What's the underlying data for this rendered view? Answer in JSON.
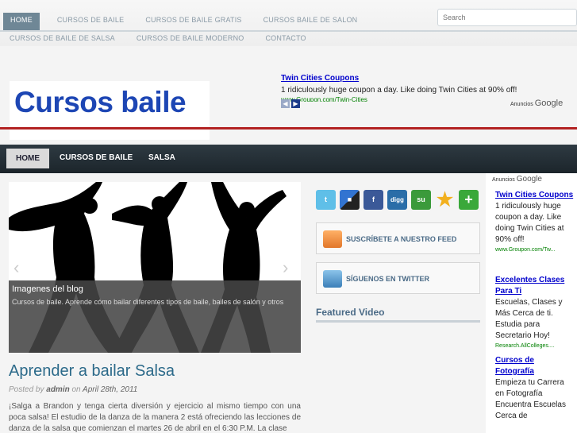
{
  "topnav": {
    "row1": [
      "HOME",
      "CURSOS DE BAILE",
      "CURSOS DE BAILE GRATIS",
      "CURSOS BAILE DE SALON"
    ],
    "row2": [
      "CURSOS DE BAILE DE SALSA",
      "CURSOS DE BAILE MODERNO",
      "CONTACTO"
    ],
    "search_placeholder": "Search"
  },
  "header": {
    "logo": "Cursos baile",
    "ad": {
      "title": "Twin Cities Coupons",
      "body": "1 ridiculously huge coupon a day. Like doing Twin Cities at 90% off!",
      "url": "www.Groupon.com/Twin-Cities"
    },
    "ads_by": "Anuncios",
    "google": "Google",
    "prev_glyph": "◀",
    "next_glyph": "▶"
  },
  "mainnav": [
    "HOME",
    "CURSOS DE BAILE",
    "SALSA"
  ],
  "slider": {
    "caption_title": "Imagenes del blog",
    "caption_text": "Cursos de baile. Aprende cómo bailar diferentes tipos de baile, bailes de salón y otros"
  },
  "post": {
    "title": "Aprender a bailar Salsa",
    "posted_by": "Posted by",
    "author": "admin",
    "on": "on",
    "date": "April 28th, 2011",
    "body": "¡Salga a Brandon y tenga cierta diversión y ejercicio al mismo tiempo con una poca salsa! El estudio de la danza de la manera 2 está ofreciendo las lecciones de danza de la salsa que comienzan el martes 26 de abril en el 6:30 P.M. La clase"
  },
  "sidebar": {
    "social_icons": [
      "twitter-icon",
      "delicious-icon",
      "facebook-icon",
      "digg-icon",
      "stumbleupon-icon",
      "favorite-star-icon",
      "add-more-icon"
    ],
    "social_glyphs": [
      "t",
      "■",
      "f",
      "digg",
      "su",
      "★",
      "+"
    ],
    "feed_label": "SUSCRÍBETE A NUESTRO FEED",
    "twitter_label": "SÍGUENOS EN TWITTER",
    "featured_video": "Featured Video"
  },
  "rsidebar": {
    "ads_by": "Anuncios",
    "google": "Google",
    "ads": [
      {
        "title": "Twin Cities Coupons",
        "body": "1 ridiculously huge coupon a day. Like doing Twin Cities at 90% off!",
        "url": "www.Groupon.com/Tw..."
      },
      {
        "title": "Excelentes Clases Para Ti",
        "body": "Escuelas, Clases y Más Cerca de ti. Estudia para Secretario Hoy!",
        "url": "Research.AllColleges...."
      },
      {
        "title": "Cursos de Fotografía",
        "body": "Empieza tu Carrera en Fotografía Encuentra Escuelas Cerca de",
        "url": ""
      }
    ]
  },
  "colors": {
    "accent_blue": "#1d46b4",
    "nav_dark": "#1c252b",
    "header_red": "#b22222",
    "post_title": "#2c6a8a"
  }
}
